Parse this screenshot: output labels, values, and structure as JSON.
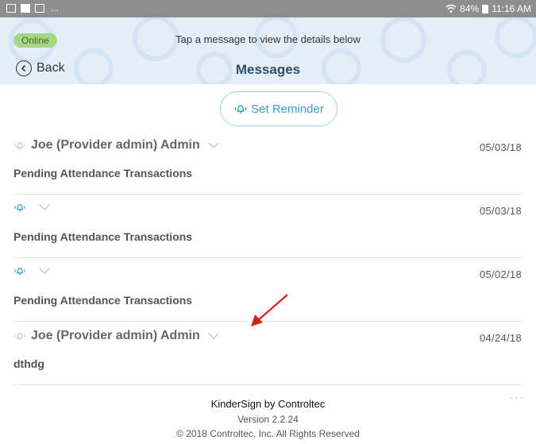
{
  "statusbar": {
    "left_dots": "...",
    "battery_text": "84%",
    "time": "11:16 AM"
  },
  "header": {
    "online_badge": "Online",
    "hint": "Tap a message to view the details below",
    "back_label": "Back",
    "title": "Messages"
  },
  "reminder_button": {
    "label": "Set Reminder"
  },
  "messages": [
    {
      "sender": "Joe (Provider admin) Admin",
      "date": "05/03/18",
      "subject": "Pending Attendance Transactions",
      "bell_color": "#c8c8c8"
    },
    {
      "sender": "",
      "date": "05/03/18",
      "subject": "Pending Attendance Transactions",
      "bell_color": "#3b9fd1"
    },
    {
      "sender": "",
      "date": "05/02/18",
      "subject": "Pending Attendance Transactions",
      "bell_color": "#3b9fd1"
    },
    {
      "sender": "Joe (Provider admin) Admin",
      "date": "04/24/18",
      "subject": "dthdg",
      "bell_color": "#c8c8c8"
    }
  ],
  "footer": {
    "app_name": "KinderSign by Controltec",
    "version": "Version 2.2.24",
    "copyright": "© 2018 Controltec, Inc. All Rights Reserved"
  },
  "colors": {
    "accent": "#3b9fd1",
    "title": "#2f4f6e",
    "online_bg": "#a6d785",
    "header_bg": "#e3eef8",
    "arrow": "#d32020"
  }
}
